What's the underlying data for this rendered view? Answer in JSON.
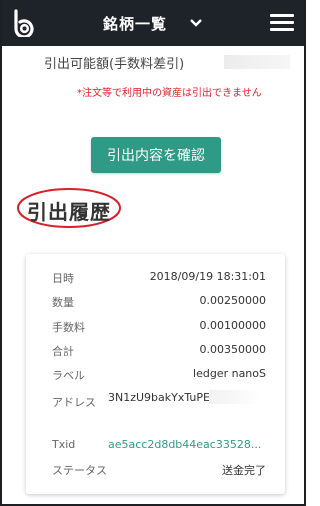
{
  "header": {
    "title": "銘柄一覧"
  },
  "withdraw": {
    "available_label": "引出可能額(手数料差引)",
    "note": "*注文等で利用中の資産は引出できません",
    "confirm_button": "引出内容を確認"
  },
  "history": {
    "title": "引出履歴",
    "rows": [
      {
        "label": "日時",
        "value": "2018/09/19 18:31:01"
      },
      {
        "label": "数量",
        "value": "0.00250000"
      },
      {
        "label": "手数料",
        "value": "0.00100000"
      },
      {
        "label": "合計",
        "value": "0.00350000"
      },
      {
        "label": "ラベル",
        "value": "ledger nanoS"
      },
      {
        "label": "アドレス",
        "value": "3N1zU9bakYxTuPEaGi"
      },
      {
        "label": "Txid",
        "value": "ae5acc2d8db44eac33528..."
      },
      {
        "label": "ステータス",
        "value": "送金完了"
      }
    ]
  },
  "colors": {
    "header_bg": "#1e2229",
    "accent": "#2f9b86",
    "warning": "#e0222b",
    "highlight_circle": "#d8202a"
  },
  "icons": {
    "logo": "brand-logo-icon",
    "chevron": "chevron-down-icon",
    "menu": "hamburger-menu-icon"
  }
}
